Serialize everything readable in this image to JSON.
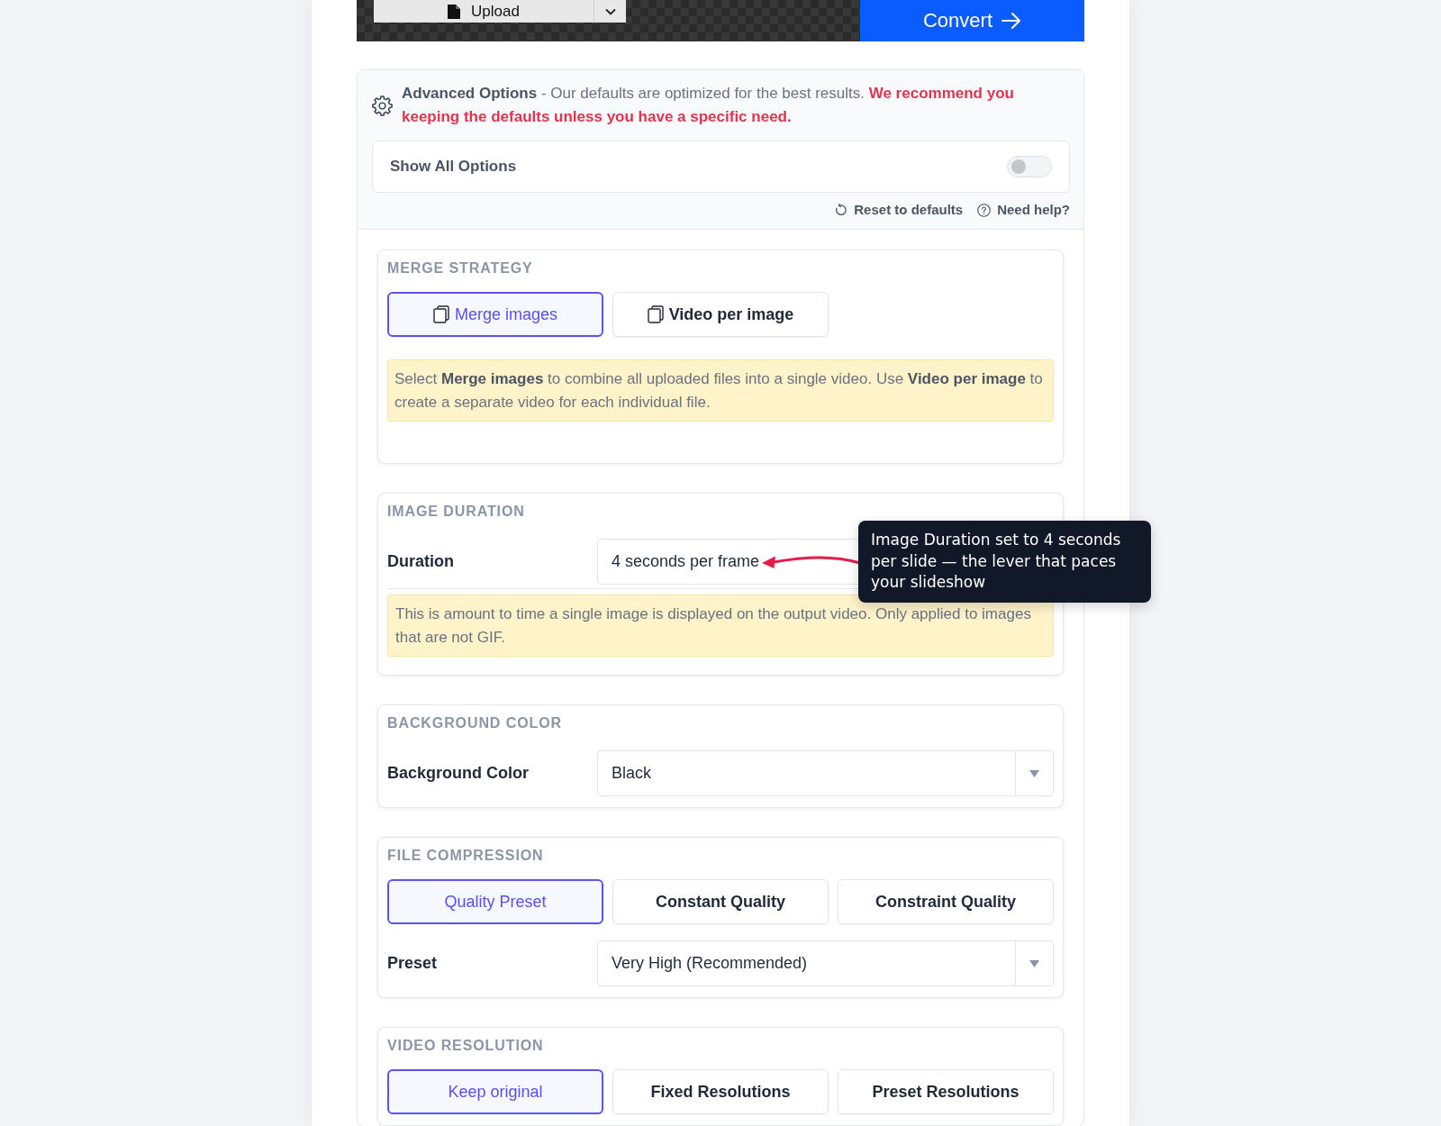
{
  "toolbar": {
    "upload": "Upload",
    "convert": "Convert"
  },
  "advanced": {
    "title": "Advanced Options",
    "description": "- Our defaults are optimized for the best results.",
    "warning": "We recommend you keeping the defaults unless you have a specific need.",
    "show_all": {
      "label": "Show All Options",
      "on": false
    },
    "links": [
      {
        "kind": "reset",
        "label": "Reset to defaults"
      },
      {
        "kind": "help",
        "label": "Need help?"
      }
    ]
  },
  "sections": [
    {
      "title": "MERGE STRATEGY",
      "rows": [
        {
          "kind": "iconchoices",
          "options": [
            {
              "label": "Merge images",
              "selected": true
            },
            {
              "label": "Video per image",
              "selected": false
            }
          ]
        },
        {
          "kind": "note",
          "text": "Select **Merge images** to combine all uploaded files into a single video. Use **Video per image** to create a separate video for each individual file."
        }
      ]
    },
    {
      "title": "IMAGE DURATION",
      "rows": [
        {
          "kind": "field",
          "label": "Duration",
          "value": "4 seconds per frame",
          "tooltip": "Image Duration set to 4 seconds per slide — the lever that paces your slideshow"
        },
        {
          "kind": "note",
          "text": "This is amount to time a single image is displayed on the output video. Only applied to images that are not GIF."
        }
      ]
    },
    {
      "title": "BACKGROUND COLOR",
      "rows": [
        {
          "kind": "select",
          "label": "Background Color",
          "value": "Black"
        }
      ]
    },
    {
      "title": "FILE COMPRESSION",
      "rows": [
        {
          "kind": "choices",
          "options": [
            {
              "label": "Quality Preset",
              "selected": true
            },
            {
              "label": "Constant Quality",
              "selected": false
            },
            {
              "label": "Constraint Quality",
              "selected": false
            }
          ]
        },
        {
          "kind": "select",
          "label": "Preset",
          "value": "Very High (Recommended)"
        }
      ]
    },
    {
      "title": "VIDEO RESOLUTION",
      "rows": [
        {
          "kind": "choices",
          "options": [
            {
              "label": "Keep original",
              "selected": true
            },
            {
              "label": "Fixed Resolutions",
              "selected": false
            },
            {
              "label": "Preset Resolutions",
              "selected": false
            }
          ]
        }
      ]
    }
  ]
}
